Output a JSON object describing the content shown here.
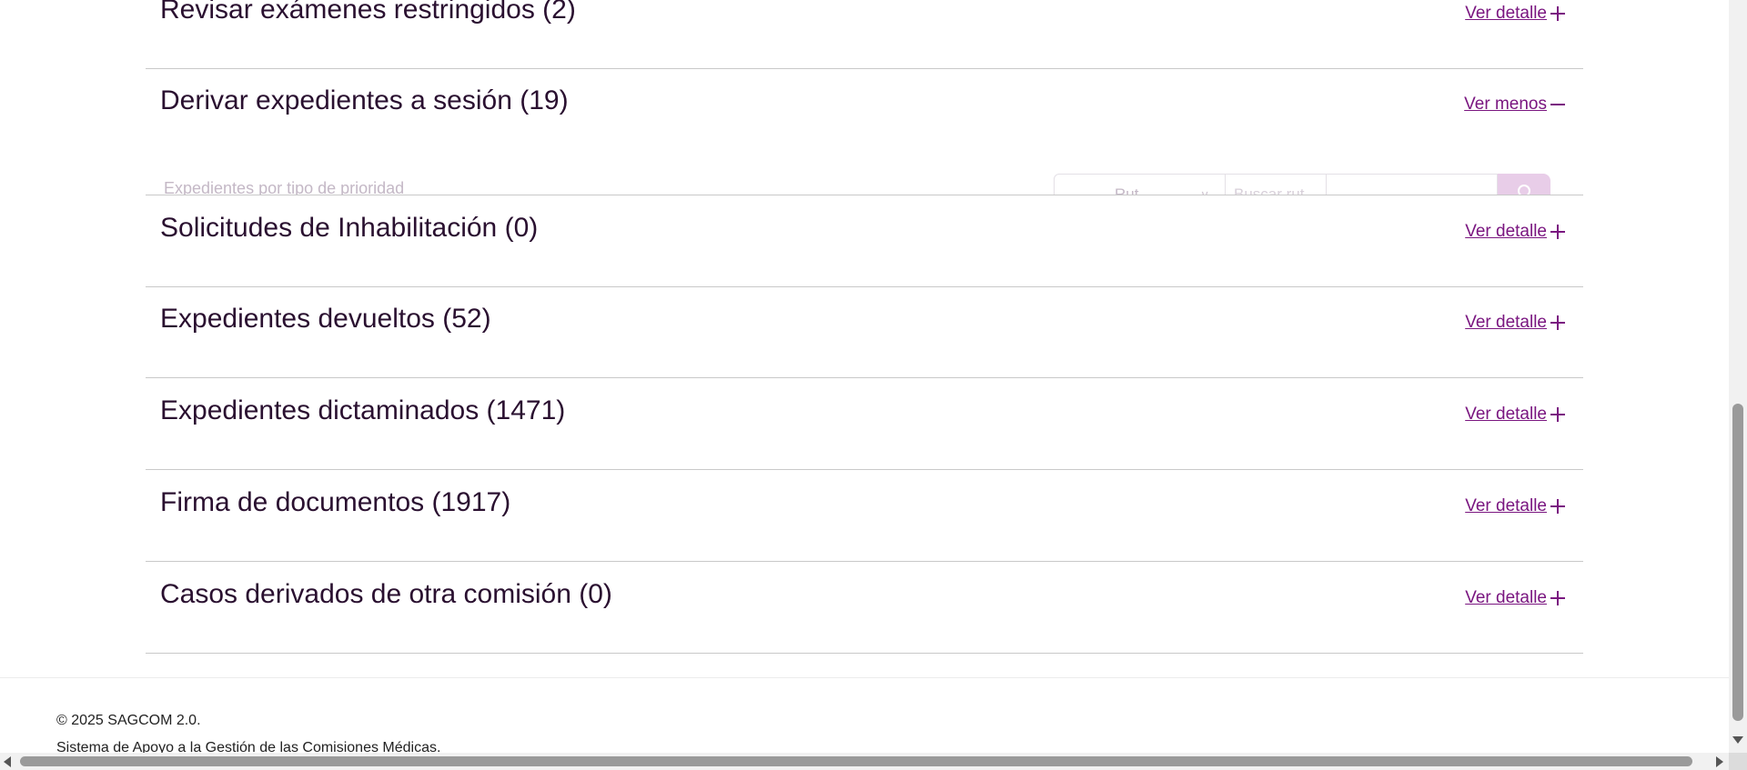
{
  "sections": [
    {
      "title": "Revisar exámenes restringidos (2)",
      "link": "Ver detalle ",
      "icon": "plus-icon"
    },
    {
      "title": "Derivar expedientes a sesión (19)",
      "link": "Ver menos ",
      "icon": "minus-icon"
    },
    {
      "title": "Solicitudes de Inhabilitación (0)",
      "link": "Ver detalle ",
      "icon": "plus-icon"
    },
    {
      "title": "Expedientes devueltos (52)",
      "link": "Ver detalle ",
      "icon": "plus-icon"
    },
    {
      "title": "Expedientes dictaminados (1471)",
      "link": "Ver detalle ",
      "icon": "plus-icon"
    },
    {
      "title": "Firma de documentos (1917)",
      "link": "Ver detalle ",
      "icon": "plus-icon"
    },
    {
      "title": "Casos derivados de otra comisión (0)",
      "link": "Ver detalle ",
      "icon": "plus-icon"
    }
  ],
  "expanded": {
    "label": "Expedientes por tipo de prioridad",
    "filter_select_value": "Rut",
    "search_placeholder": "Buscar rut"
  },
  "footer": {
    "copyright": "© 2025 SAGCOM 2.0.",
    "subtitle": "Sistema de Apoyo a la Gestión de las Comisiones Médicas."
  },
  "colors": {
    "accent": "#7a1680",
    "title": "#2a1030",
    "divider": "#c9c9c9"
  }
}
